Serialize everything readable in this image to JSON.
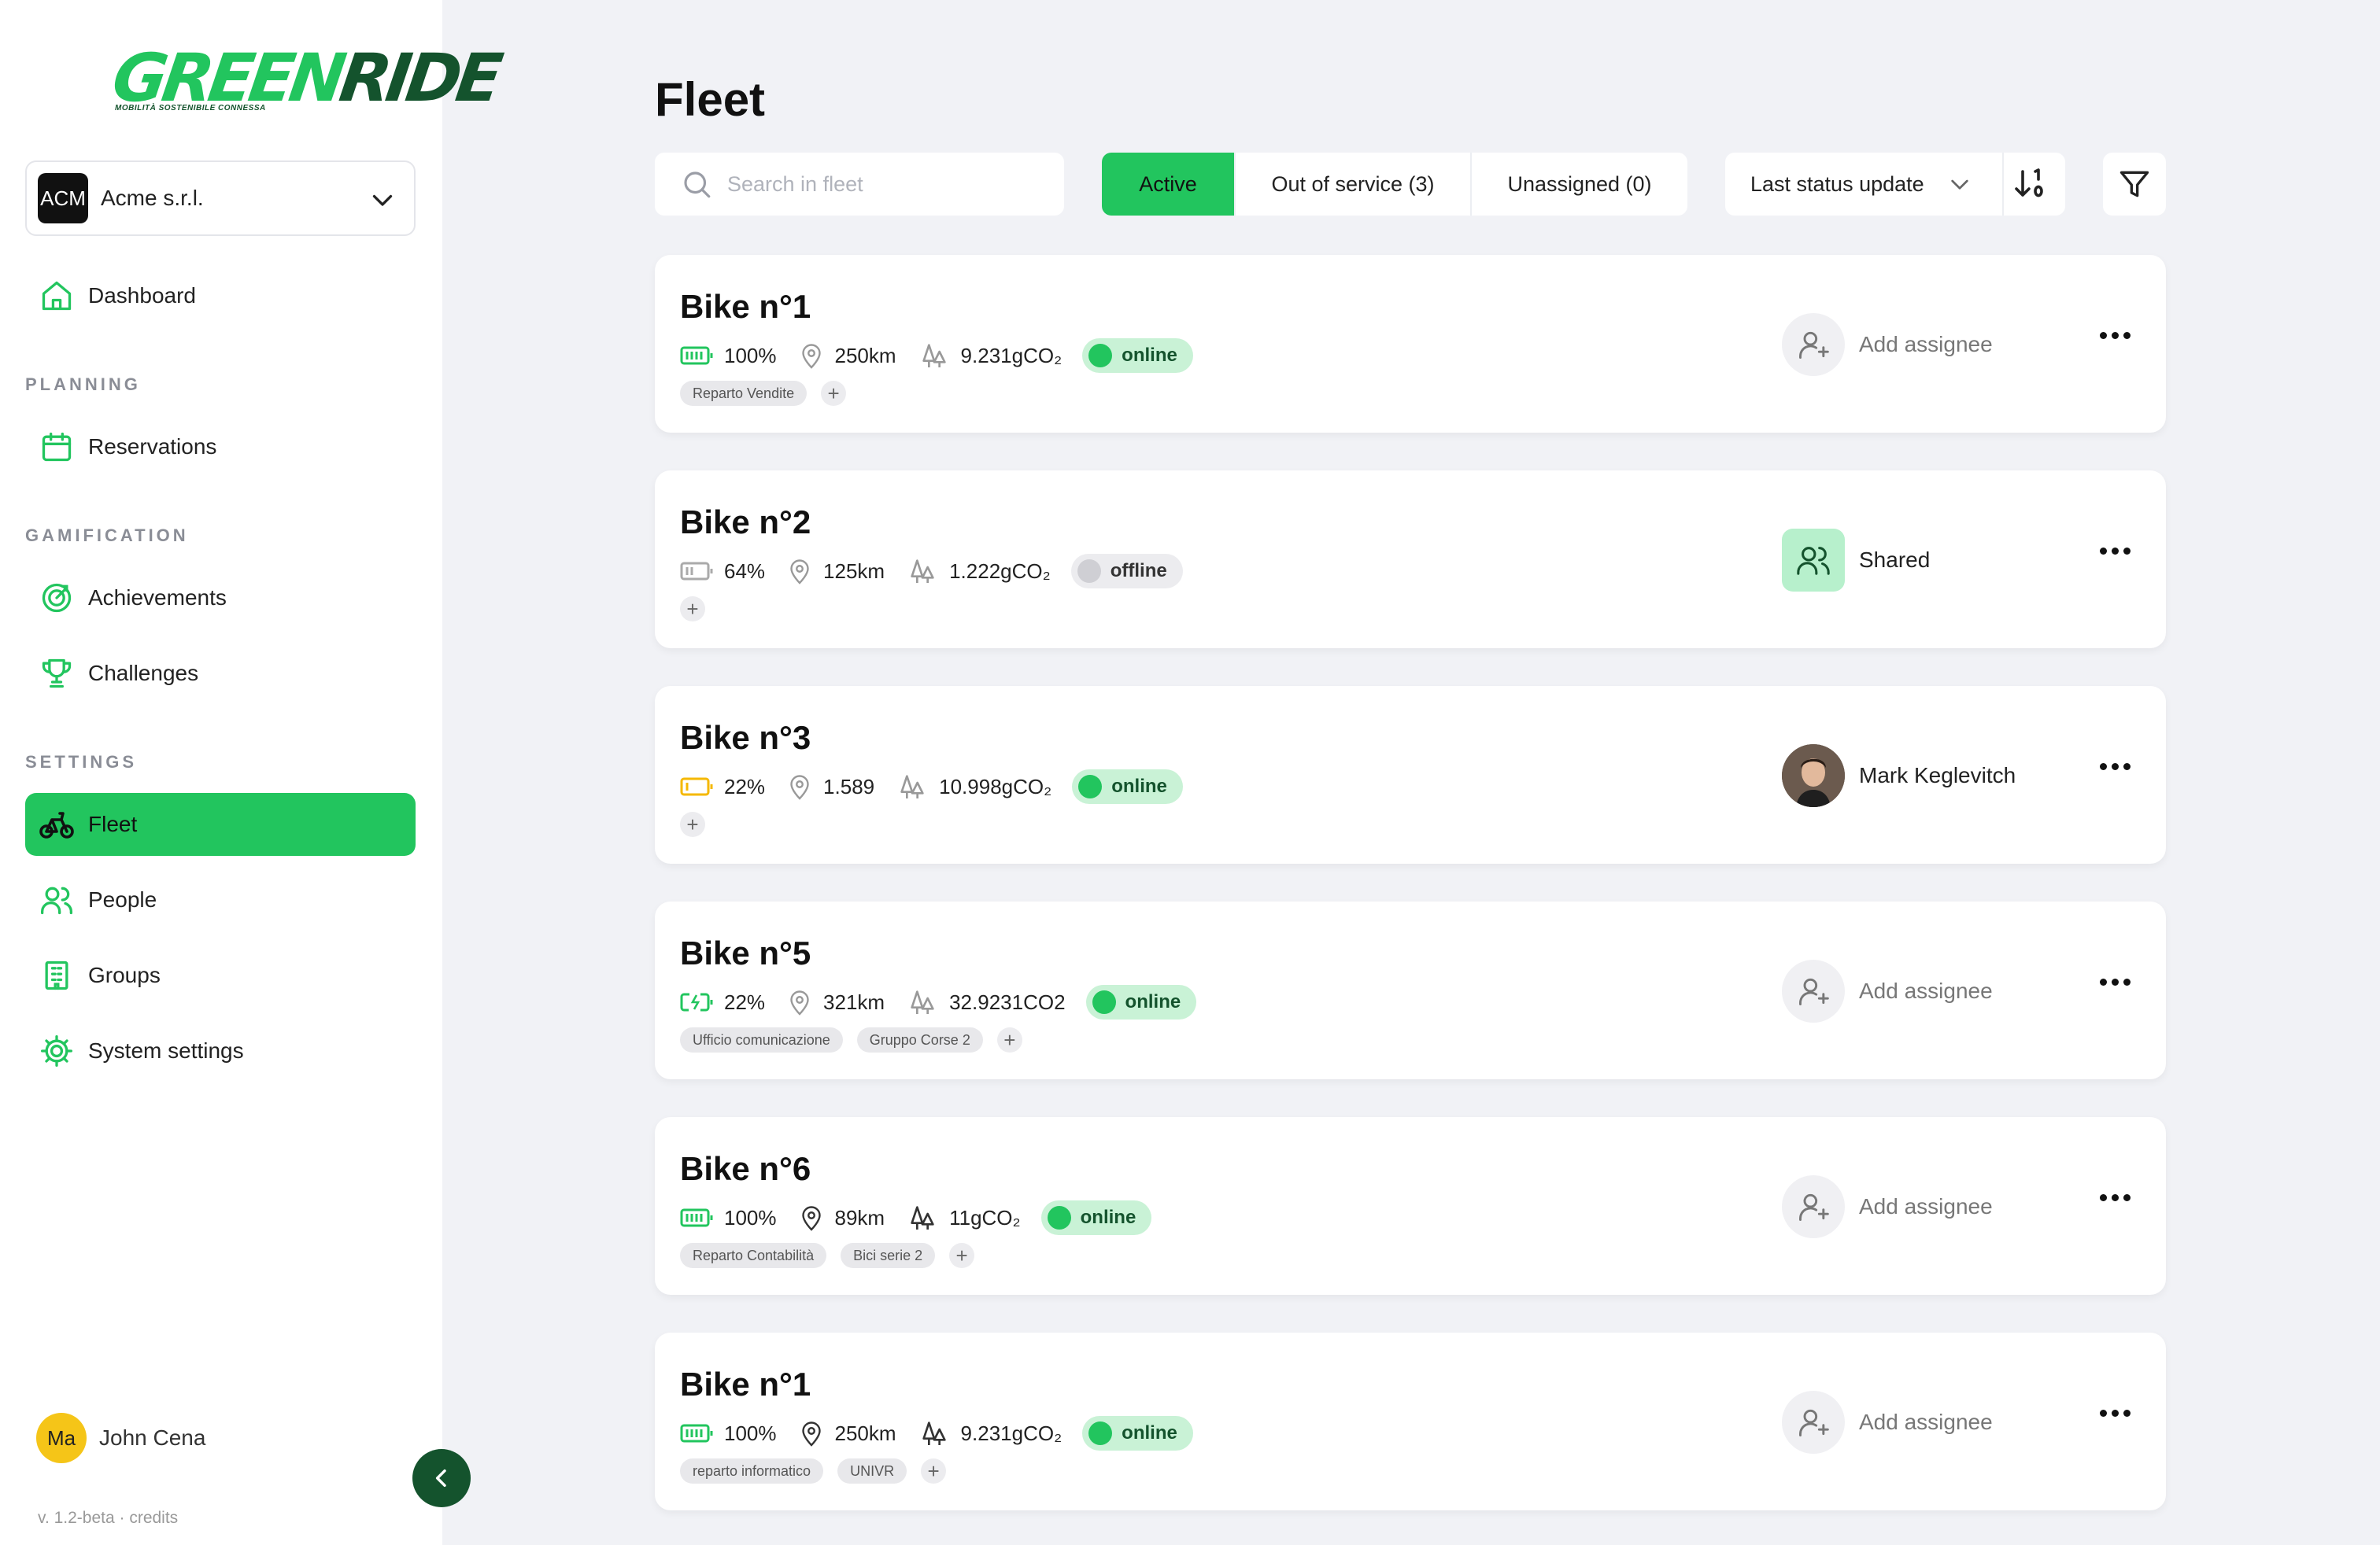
{
  "app": {
    "logo_part1": "GREEN",
    "logo_part2": "RIDE",
    "logo_tagline": "MOBILITÀ SOSTENIBILE CONNESSA",
    "brand_color": "#22c55e",
    "brand_dark": "#14532d"
  },
  "org": {
    "badge": "ACM",
    "name": "Acme s.r.l."
  },
  "nav": {
    "dashboard": "Dashboard",
    "planning_section": "PLANNING",
    "reservations": "Reservations",
    "gamification_section": "GAMIFICATION",
    "achievements": "Achievements",
    "challenges": "Challenges",
    "settings_section": "SETTINGS",
    "fleet": "Fleet",
    "people": "People",
    "groups": "Groups",
    "system_settings": "System settings"
  },
  "user": {
    "initials": "Ma",
    "name": "John Cena"
  },
  "version": "v. 1.2-beta · credits",
  "page": {
    "title": "Fleet"
  },
  "search": {
    "placeholder": "Search in fleet"
  },
  "tabs": {
    "active": "Active",
    "out_of_service": "Out of service (3)",
    "unassigned": "Unassigned (0)"
  },
  "sort": {
    "label": "Last status update"
  },
  "bikes": [
    {
      "name": "Bike n°1",
      "battery": "100%",
      "distance": "250km",
      "co2": "9.231gCO₂",
      "status": "online",
      "tags": [
        "Reparto Vendite"
      ],
      "assignee": "Add assignee"
    },
    {
      "name": "Bike n°2",
      "battery": "64%",
      "distance": "125km",
      "co2": "1.222gCO₂",
      "status": "offline",
      "tags": [],
      "assignee": "Shared"
    },
    {
      "name": "Bike n°3",
      "battery": "22%",
      "distance": "1.589",
      "co2": "10.998gCO₂",
      "status": "online",
      "tags": [],
      "assignee": "Mark Keglevitch"
    },
    {
      "name": "Bike n°5",
      "battery": "22%",
      "distance": "321km",
      "co2": "32.9231CO2",
      "status": "online",
      "tags": [
        "Ufficio comunicazione",
        "Gruppo Corse 2"
      ],
      "assignee": "Add assignee"
    },
    {
      "name": "Bike n°6",
      "battery": "100%",
      "distance": "89km",
      "co2": "11gCO₂",
      "status": "online",
      "tags": [
        "Reparto Contabilità",
        "Bici serie 2"
      ],
      "assignee": "Add assignee"
    },
    {
      "name": "Bike n°1",
      "battery": "100%",
      "distance": "250km",
      "co2": "9.231gCO₂",
      "status": "online",
      "tags": [
        "reparto informatico",
        "UNIVR"
      ],
      "assignee": "Add assignee"
    }
  ]
}
